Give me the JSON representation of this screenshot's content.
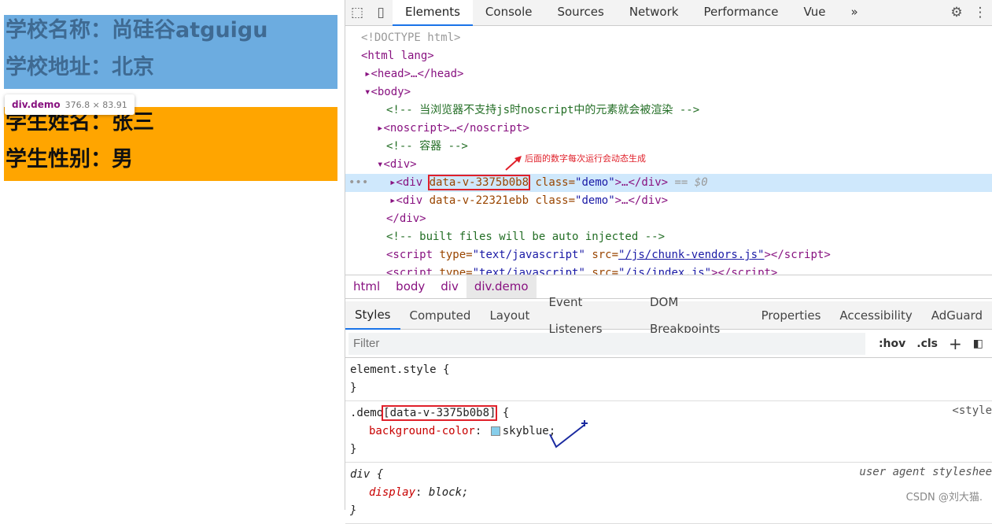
{
  "page": {
    "school_name": "学校名称：尚硅谷atguigu",
    "school_addr": "学校地址：北京",
    "student_name": "学生姓名：张三",
    "student_sex": "学生性别：男",
    "block1_color": "#6cace0",
    "block2_color": "#ffa500"
  },
  "tooltip": {
    "tag": "div.demo",
    "size": "376.8 × 83.91"
  },
  "devtools": {
    "tabs": [
      "Elements",
      "Console",
      "Sources",
      "Network",
      "Performance",
      "Vue",
      "»"
    ],
    "icons": [
      "inspect-icon",
      "device-toggle-icon",
      "gear-icon",
      "more-vert-icon"
    ],
    "dom": {
      "doctype": "<!DOCTYPE html>",
      "html": "<html lang>",
      "head": "<head>…</head>",
      "body": "<body>",
      "comment1": "<!-- 当浏览器不支持js时noscript中的元素就会被渲染 -->",
      "noscript": "<noscript>…</noscript>",
      "comment2": "<!-- 容器 -->",
      "div_open": "<div>",
      "row1": {
        "open": "<div ",
        "attr": "data-v-3375b0b8",
        "cls": " class=",
        "val": "\"demo\"",
        "close": ">…</div>",
        "eq": " == $0"
      },
      "row2": {
        "open": "<div ",
        "attr": "data-v-22321ebb",
        "cls": " class=",
        "val": "\"demo\"",
        "close": ">…</div>"
      },
      "div_close": "</div>",
      "comment3": "<!-- built files will be auto injected -->",
      "script1": {
        "open": "<script ",
        "t": "type=",
        "tv": "\"text/javascript\"",
        "s": " src=",
        "sv": "\"/js/chunk-vendors.js\"",
        "close": "></script>"
      },
      "script2": {
        "open": "<script ",
        "t": "type=",
        "tv": "\"text/javascript\"",
        "s": " src=",
        "sv": "\"/js/index.js\"",
        "close": "></script>"
      }
    },
    "annotation": "后面的数字每次运行会动态生成",
    "breadcrumb": [
      "html",
      "body",
      "div",
      "div.demo"
    ],
    "styles_tabs": [
      "Styles",
      "Computed",
      "Layout",
      "Event Listeners",
      "DOM Breakpoints",
      "Properties",
      "Accessibility",
      "AdGuard"
    ],
    "filter_placeholder": "Filter",
    "hov": ":hov",
    "cls": ".cls",
    "plus": "+",
    "rules": {
      "element_style": "element.style {",
      "close": "}",
      "demo_sel": ".demo",
      "demo_attr": "[data-v-3375b0b8]",
      "demo_open": " {",
      "demo_prop": "background-color",
      "demo_val": "skyblue;",
      "demo_src": "<style",
      "div_sel": "div {",
      "div_prop": "display",
      "div_val": "block;",
      "div_src": "user agent styleshee"
    },
    "watermark": "CSDN @刘大猫."
  }
}
